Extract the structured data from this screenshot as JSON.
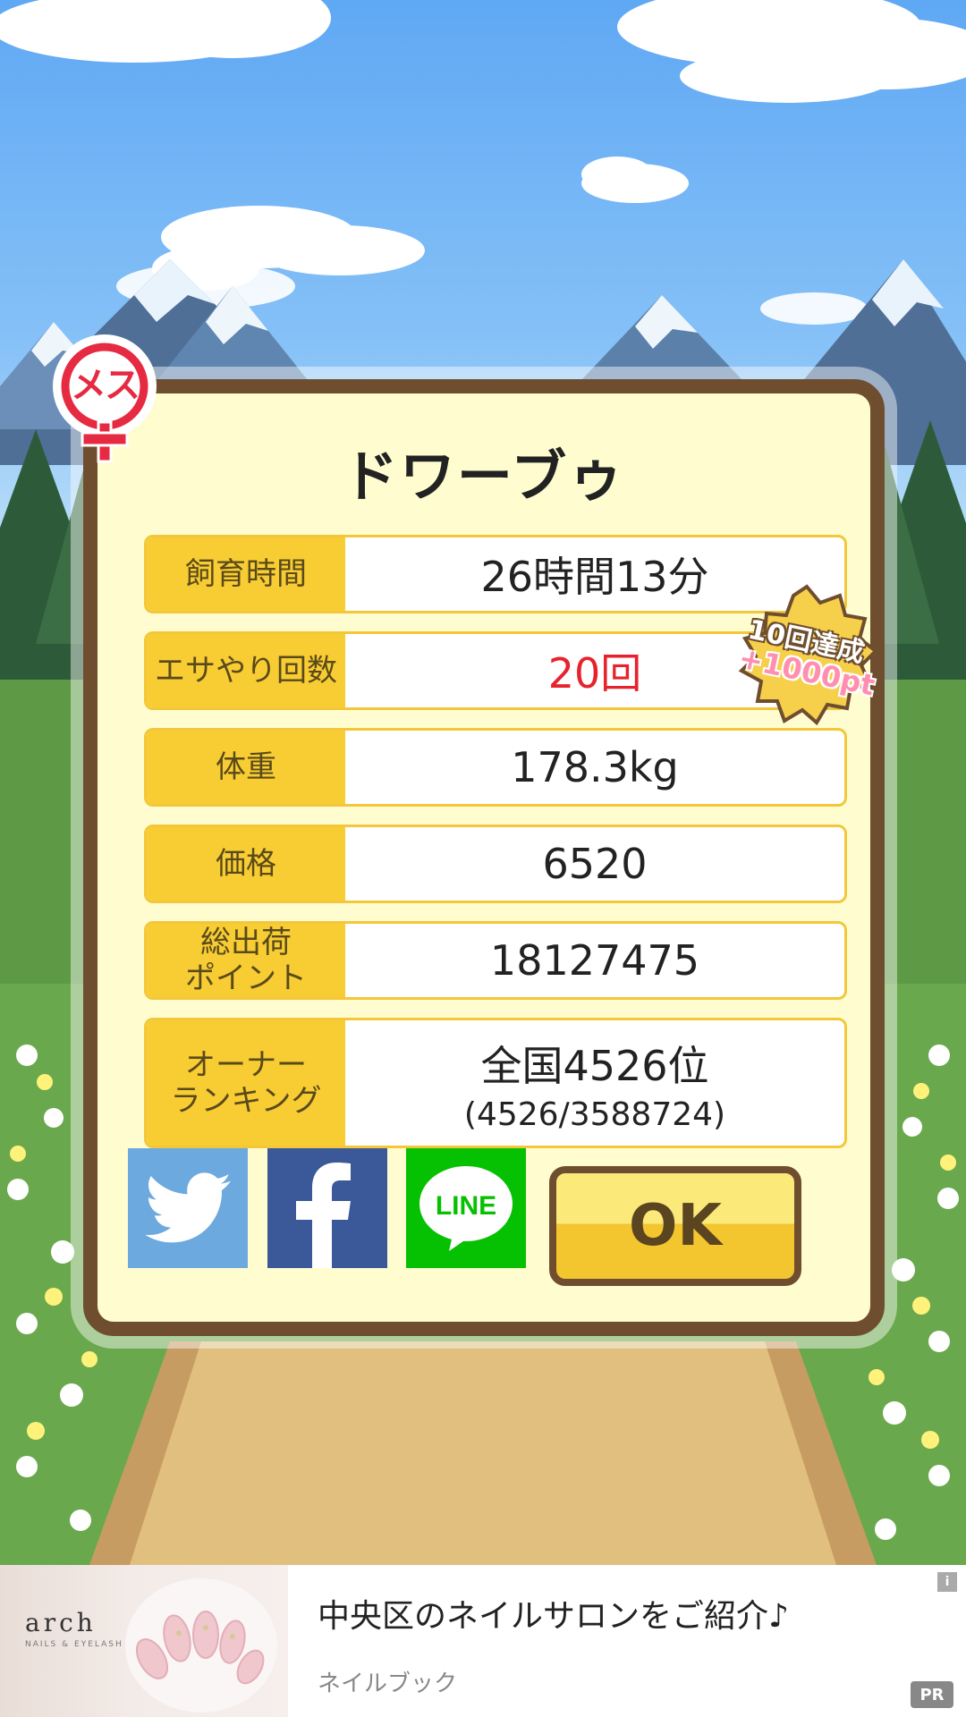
{
  "pet": {
    "gender_label": "メス",
    "name": "ドワーブゥ"
  },
  "stats": [
    {
      "label": "飼育時間",
      "value": "26時間13分",
      "highlight": false
    },
    {
      "label": "エサやり回数",
      "value": "20回",
      "highlight": true
    },
    {
      "label": "体重",
      "value": "178.3kg",
      "highlight": false
    },
    {
      "label": "価格",
      "value": "6520",
      "highlight": false
    },
    {
      "label_line1": "総出荷",
      "label_line2": "ポイント",
      "value": "18127475",
      "highlight": false
    },
    {
      "label_line1": "オーナー",
      "label_line2": "ランキング",
      "value": "全国4526位",
      "sub_value": "(4526/3588724)",
      "highlight": false
    }
  ],
  "bonus_badge": {
    "line1": "10回達成",
    "line2": "+1000pt"
  },
  "share": {
    "twitter_icon": "twitter-icon",
    "facebook_icon": "facebook-icon",
    "line_label": "LINE"
  },
  "ok_button": {
    "label": "OK"
  },
  "ad": {
    "brand": "arch",
    "brand_sub": "NAILS & EYELASH",
    "title": "中央区のネイルサロンをご紹介♪",
    "source": "ネイルブック",
    "pr_label": "PR",
    "info_label": "i"
  },
  "colors": {
    "frame": "#6f4e2f",
    "panel": "#fffdd0",
    "label_bg": "#f8cd33",
    "highlight_value": "#e8222c",
    "twitter": "#6ca9de",
    "facebook": "#3b5998",
    "line": "#06c101"
  }
}
